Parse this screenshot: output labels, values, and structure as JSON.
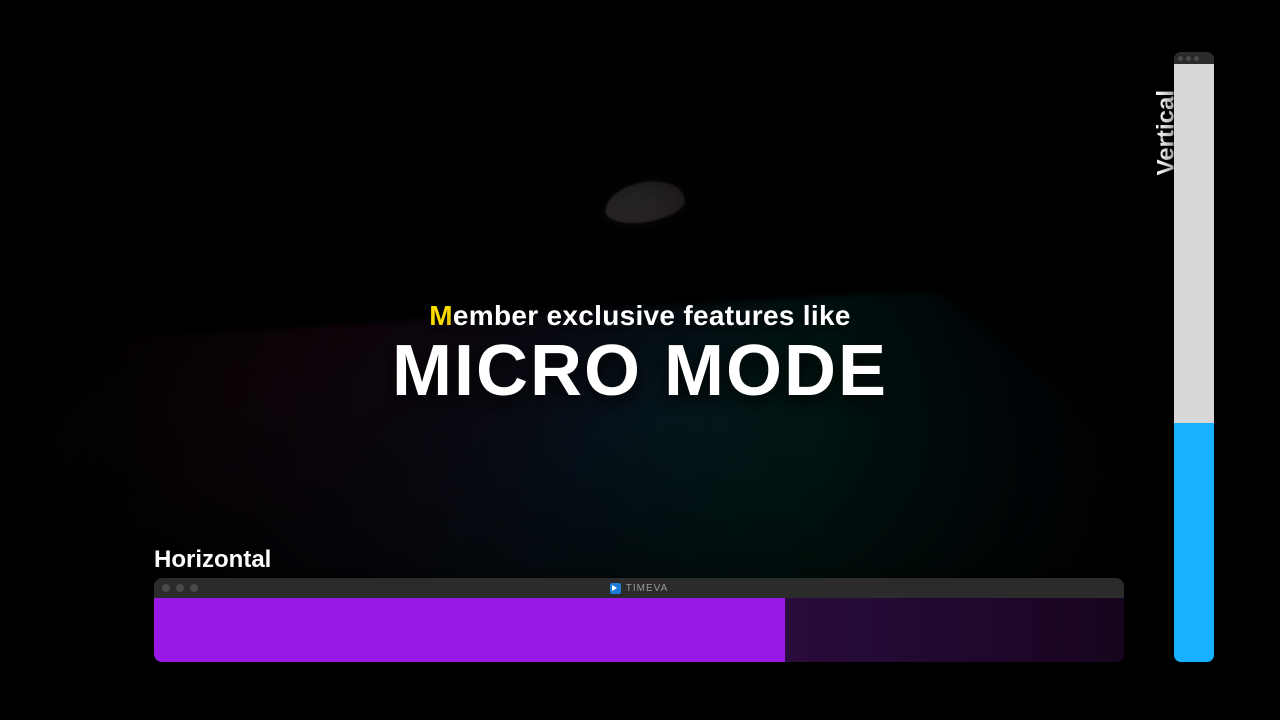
{
  "headline": {
    "subtitle_first_letter": "M",
    "subtitle_rest": "ember exclusive features like",
    "title": "MICRO MODE"
  },
  "horizontal": {
    "label": "Horizontal",
    "window_title": "TIMEVA",
    "progress_percent": 65,
    "fill_color": "#9a18e6",
    "track_color": "#1a0726"
  },
  "vertical": {
    "label": "Vertical",
    "progress_percent": 40,
    "fill_color": "#17b1ff",
    "track_color": "#d7d7d7"
  }
}
